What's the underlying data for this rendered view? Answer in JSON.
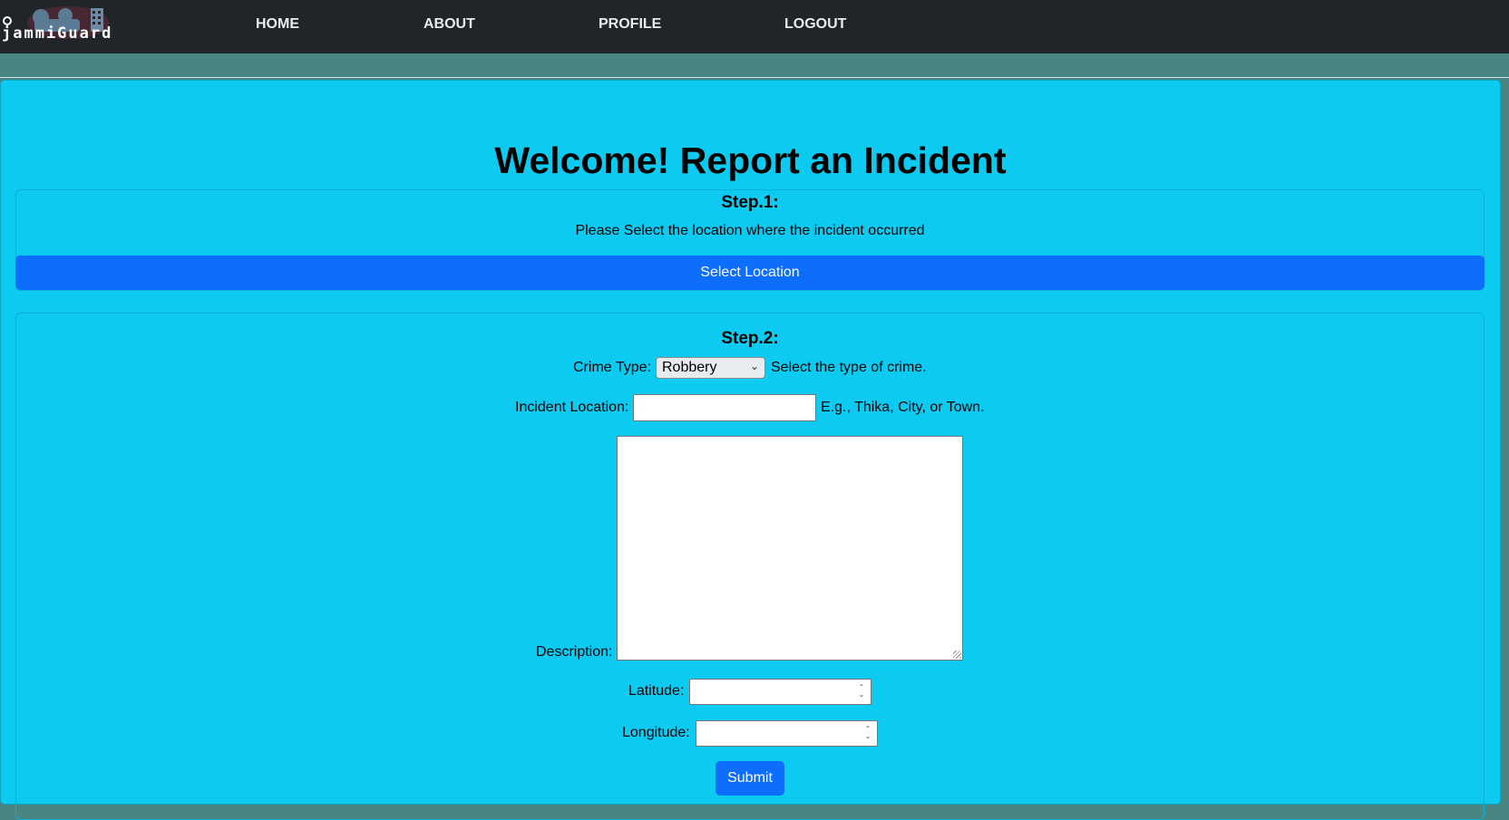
{
  "nav": {
    "logo_text": "jammiGuard",
    "links": [
      "HOME",
      "ABOUT",
      "PROFILE",
      "LOGOUT"
    ]
  },
  "page": {
    "title": "Welcome! Report an Incident"
  },
  "step1": {
    "title": "Step.1:",
    "instruction": "Please Select the location where the incident occurred",
    "button_label": "Select Location"
  },
  "step2": {
    "title": "Step.2:",
    "crime_type_label": "Crime Type:",
    "crime_type_value": "Robbery",
    "crime_type_hint": "Select the type of crime.",
    "location_label": "Incident Location:",
    "location_value": "",
    "location_hint": "E.g., Thika, City, or Town.",
    "description_label": "Description:",
    "description_value": "",
    "latitude_label": "Latitude:",
    "latitude_value": "",
    "longitude_label": "Longitude:",
    "longitude_value": "",
    "submit_label": "Submit"
  },
  "colors": {
    "navbar": "#212529",
    "card": "#0dcaf0",
    "primary": "#0d6efd",
    "band": "#4a8583"
  }
}
